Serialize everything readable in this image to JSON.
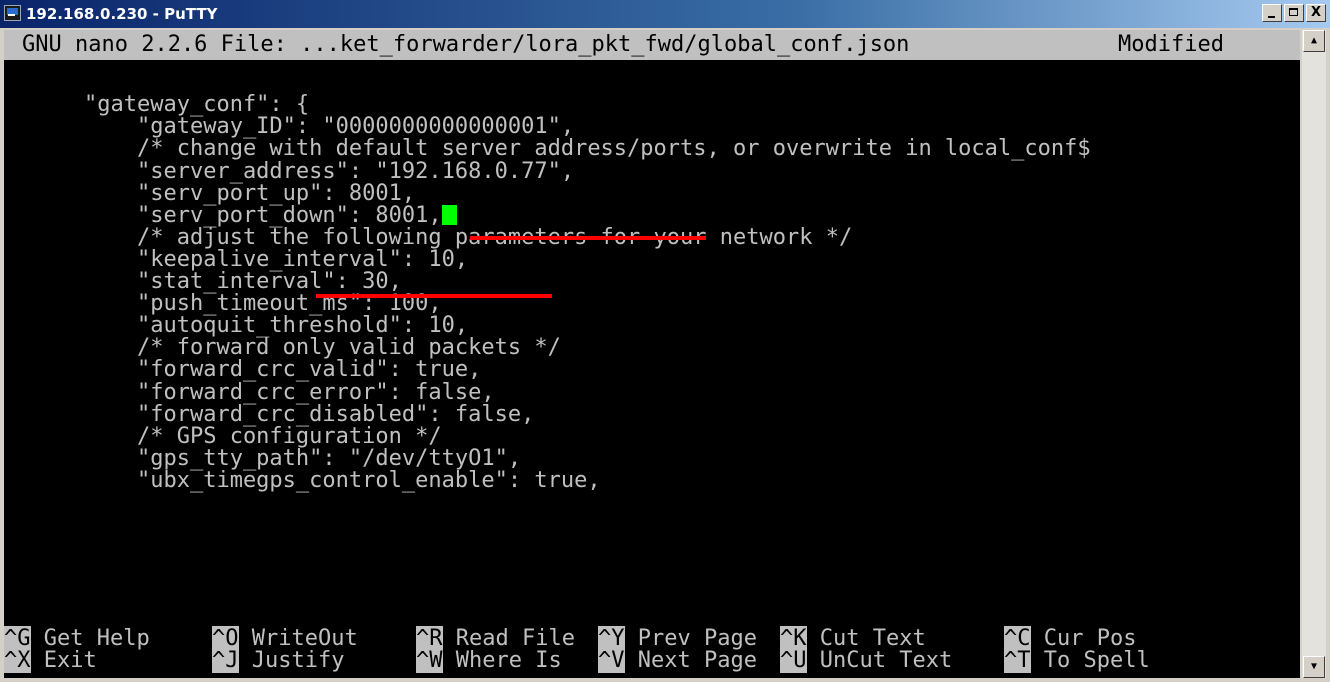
{
  "window": {
    "title": "192.168.0.230 - PuTTY",
    "minimize_label": "_",
    "maximize_label": "",
    "close_label": "X"
  },
  "nano": {
    "header_title": "GNU nano 2.2.6 File: ...ket_forwarder/lora_pkt_fwd/global_conf.json",
    "modified_label": "Modified"
  },
  "editor": {
    "lines": [
      "",
      "",
      "\"gateway_conf\": {",
      "    \"gateway_ID\": \"0000000000000001\",",
      "    /* change with default server address/ports, or overwrite in local_conf$",
      "    \"server_address\": \"192.168.0.77\",",
      "    \"serv_port_up\": 8001,",
      "    \"serv_port_down\": 8001,",
      "    /* adjust the following parameters for your network */",
      "    \"keepalive_interval\": 10,",
      "    \"stat_interval\": 30,",
      "    \"push_timeout_ms\": 100,",
      "    \"autoquit_threshold\": 10,",
      "    /* forward only valid packets */",
      "    \"forward_crc_valid\": true,",
      "    \"forward_crc_error\": false,",
      "    \"forward_crc_disabled\": false,",
      "    /* GPS configuration */",
      "    \"gps_tty_path\": \"/dev/ttyO1\",",
      "    \"ubx_timegps_control_enable\": true,"
    ]
  },
  "shortcuts": {
    "row1": [
      {
        "key": "^G",
        "label": " Get Help"
      },
      {
        "key": "^O",
        "label": " WriteOut"
      },
      {
        "key": "^R",
        "label": " Read File"
      },
      {
        "key": "^Y",
        "label": " Prev Page"
      },
      {
        "key": "^K",
        "label": " Cut Text"
      },
      {
        "key": "^C",
        "label": " Cur Pos"
      }
    ],
    "row2": [
      {
        "key": "^X",
        "label": " Exit"
      },
      {
        "key": "^J",
        "label": " Justify"
      },
      {
        "key": "^W",
        "label": " Where Is"
      },
      {
        "key": "^V",
        "label": " Next Page"
      },
      {
        "key": "^U",
        "label": " UnCut Text"
      },
      {
        "key": "^T",
        "label": " To Spell"
      }
    ]
  },
  "scrollbar": {
    "up_arrow": "▲",
    "down_arrow": "▼"
  },
  "colors": {
    "cursor": "#00ff00",
    "annotation": "#ff0000",
    "text": "#c0c0c0",
    "background": "#000000"
  }
}
